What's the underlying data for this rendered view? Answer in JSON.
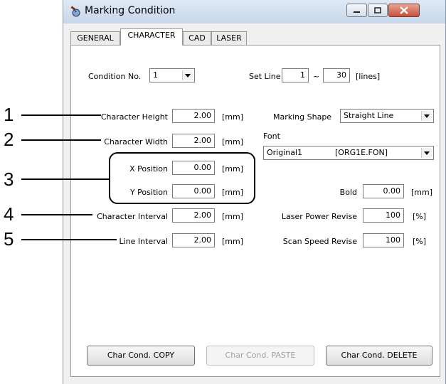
{
  "window": {
    "title": "Marking Condition",
    "icon": "marking-app-icon",
    "controls": [
      "minimize-icon",
      "maximize-icon",
      "close-icon"
    ]
  },
  "tabs": [
    {
      "label": "GENERAL",
      "active": false
    },
    {
      "label": "CHARACTER",
      "active": true
    },
    {
      "label": "CAD",
      "active": false
    },
    {
      "label": "LASER",
      "active": false
    }
  ],
  "condition": {
    "label": "Condition No.",
    "value": "1"
  },
  "set_line": {
    "label": "Set Line",
    "from": "1",
    "sep": "~",
    "to": "30",
    "unit": "[lines]"
  },
  "fields": {
    "char_height": {
      "label": "Character Height",
      "value": "2.00",
      "unit": "[mm]"
    },
    "char_width": {
      "label": "Character Width",
      "value": "2.00",
      "unit": "[mm]"
    },
    "x_pos": {
      "label": "X Position",
      "value": "0.00",
      "unit": "[mm]"
    },
    "y_pos": {
      "label": "Y Position",
      "value": "0.00",
      "unit": "[mm]"
    },
    "char_interval": {
      "label": "Character Interval",
      "value": "2.00",
      "unit": "[mm]"
    },
    "line_interval": {
      "label": "Line Interval",
      "value": "2.00",
      "unit": "[mm]"
    }
  },
  "right": {
    "marking_shape": {
      "label": "Marking Shape",
      "value": "Straight Line"
    },
    "font": {
      "label": "Font",
      "name": "Original1",
      "file": "[ORG1E.FON]"
    },
    "bold": {
      "label": "Bold",
      "value": "0.00",
      "unit": "[mm]"
    },
    "laser_power": {
      "label": "Laser Power Revise",
      "value": "100",
      "unit": "[%]"
    },
    "scan_speed": {
      "label": "Scan Speed Revise",
      "value": "100",
      "unit": "[%]"
    }
  },
  "buttons": {
    "copy": "Char Cond. COPY",
    "paste": "Char Cond. PASTE",
    "delete": "Char Cond. DELETE"
  },
  "callouts": [
    "1",
    "2",
    "3",
    "4",
    "5"
  ]
}
